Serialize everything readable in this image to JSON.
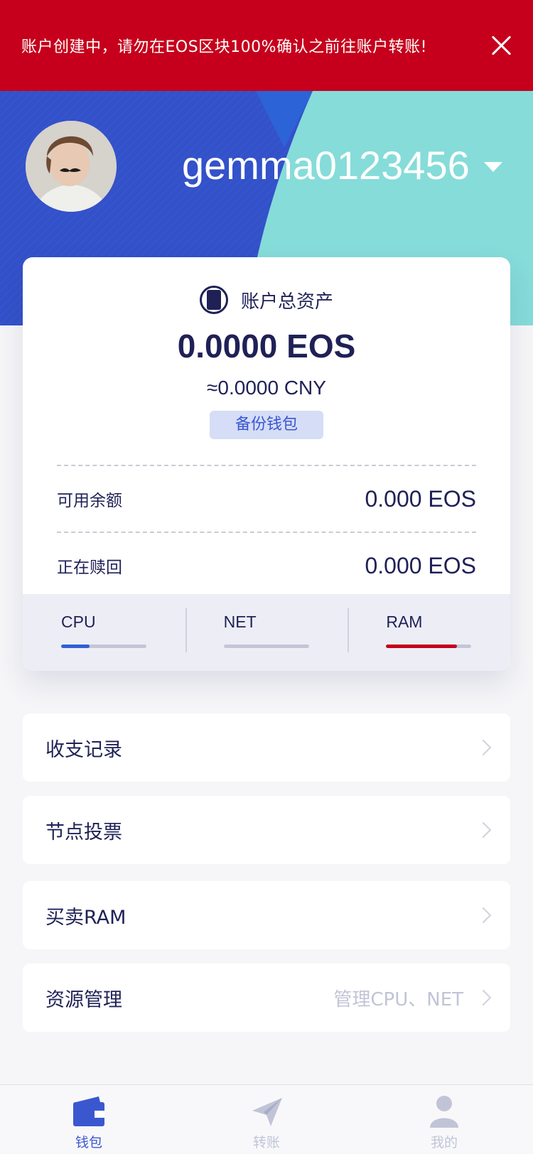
{
  "banner": {
    "text": "账户创建中，请勿在EOS区块100%确认之前往账户转账!"
  },
  "header": {
    "account_name": "gemma0123456"
  },
  "card": {
    "title": "账户总资产",
    "total_eos": "0.0000 EOS",
    "total_cny": "≈0.0000 CNY",
    "backup_label": "备份钱包",
    "rows": [
      {
        "label": "可用余额",
        "value": "0.000 EOS"
      },
      {
        "label": "正在赎回",
        "value": "0.000 EOS"
      }
    ],
    "resources": [
      {
        "name": "CPU",
        "usage": 0.33,
        "color": "#2f5fd6"
      },
      {
        "name": "NET",
        "usage": 0.0,
        "color": "#2f5fd6"
      },
      {
        "name": "RAM",
        "usage": 0.83,
        "color": "#c6001c"
      }
    ]
  },
  "menu": [
    {
      "label": "收支记录",
      "hint": ""
    },
    {
      "label": "节点投票",
      "hint": ""
    },
    {
      "label": "买卖RAM",
      "hint": ""
    },
    {
      "label": "资源管理",
      "hint": "管理CPU、NET"
    }
  ],
  "tabs": [
    {
      "label": "钱包",
      "icon": "wallet-icon",
      "active": true
    },
    {
      "label": "转账",
      "icon": "send-icon",
      "active": false
    },
    {
      "label": "我的",
      "icon": "person-icon",
      "active": false
    }
  ],
  "colors": {
    "banner": "#c6001c",
    "hero_blue": "#3351c9",
    "hero_teal": "#86dcd9",
    "text_dark": "#1f2156",
    "tab_active": "#3b57d0",
    "tab_inactive": "#c1c4d6"
  }
}
